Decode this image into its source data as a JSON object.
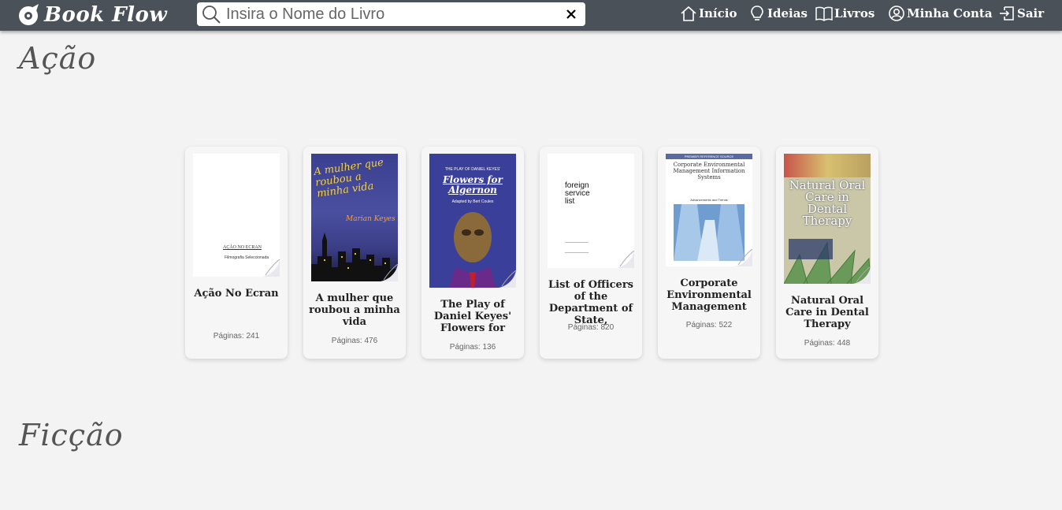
{
  "brand": {
    "name": "Book Flow",
    "logo_icon": "book-flow-logo-icon"
  },
  "search": {
    "placeholder": "Insira o Nome do Livro",
    "value": "",
    "icon": "search-icon",
    "clear_icon": "close-icon"
  },
  "nav": [
    {
      "label": "Início",
      "icon": "home-icon"
    },
    {
      "label": "Ideias",
      "icon": "lightbulb-icon"
    },
    {
      "label": "Livros",
      "icon": "book-open-icon"
    },
    {
      "label": "Minha Conta",
      "icon": "user-circle-icon"
    },
    {
      "label": "Sair",
      "icon": "logout-icon"
    }
  ],
  "sections": [
    {
      "title": "Ação"
    },
    {
      "title": "Ficção"
    }
  ],
  "books": [
    {
      "title": "Ação No Ecran",
      "pages": "Páginas: 241",
      "cover": {
        "line1": "AÇÃO NO ECRAN",
        "line2": "Filmografia Seleccionada"
      }
    },
    {
      "title": "A mulher que roubou a minha vida",
      "pages": "Páginas: 476",
      "cover": {
        "line1": "A mulher que roubou a minha vida",
        "line2": "Marian Keyes"
      }
    },
    {
      "title": "The Play of Daniel Keyes' Flowers for",
      "pages": "Páginas: 136",
      "cover": {
        "line1": "THE PLAY OF DANIEL KEYES'",
        "line2": "Flowers for Algernon",
        "line3": "Adapted by Bert Coules"
      }
    },
    {
      "title": "List of Officers of the Department of State,",
      "pages": "Páginas: 820",
      "cover": {
        "line1": "foreign service list"
      }
    },
    {
      "title": "Corporate Environmental Management",
      "pages": "Páginas: 522",
      "cover": {
        "line1": "PREMIER REFERENCE SOURCE",
        "line2": "Corporate Environmental Management Information Systems",
        "line3": "Advancements and Trends"
      }
    },
    {
      "title": "Natural Oral Care in Dental Therapy",
      "pages": "Páginas: 448",
      "cover": {
        "line1": "Natural Oral Care in Dental Therapy"
      }
    }
  ],
  "colors": {
    "header": "#4a5158",
    "background": "#f3f3f3",
    "card": "#f6f6f6"
  }
}
